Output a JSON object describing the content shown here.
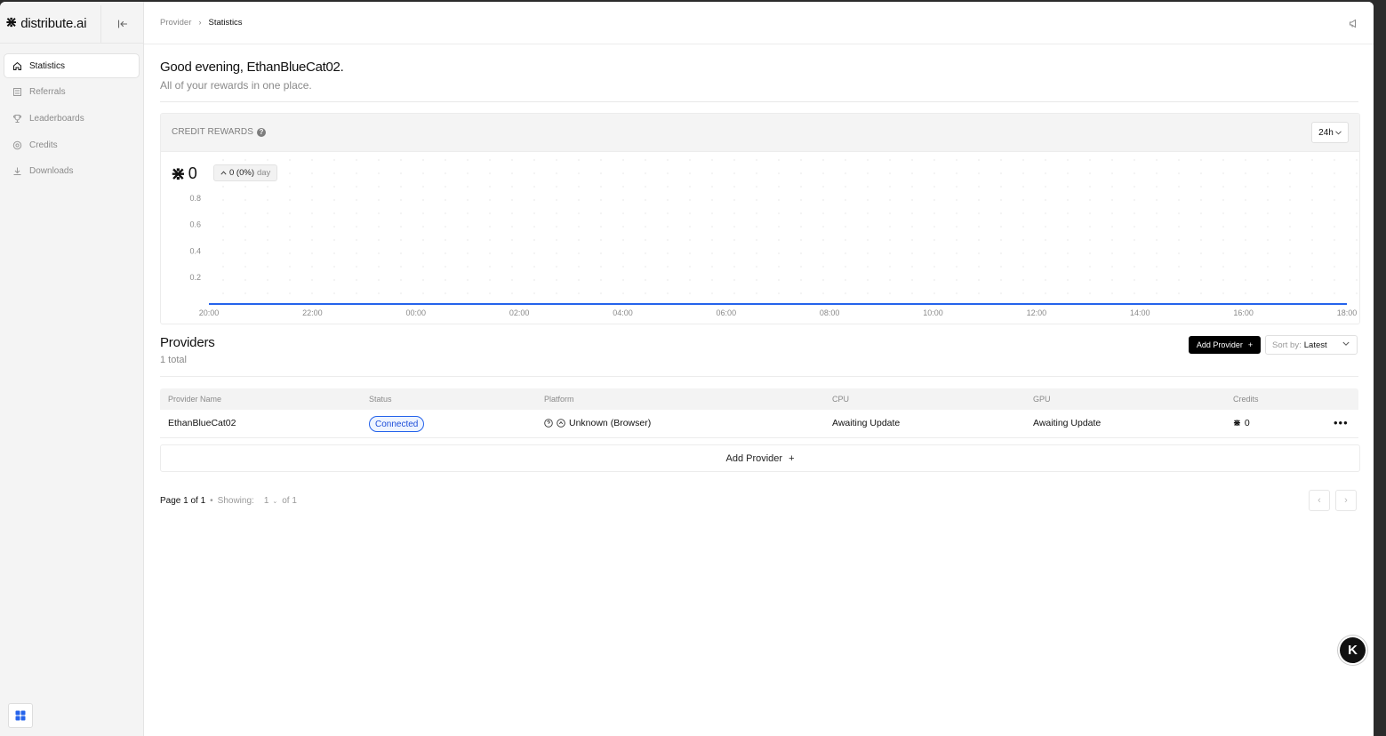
{
  "app": {
    "brand": "distribute.ai"
  },
  "sidebar": {
    "items": [
      {
        "label": "Statistics",
        "icon": "home-icon",
        "active": true
      },
      {
        "label": "Referrals",
        "icon": "referral-icon",
        "active": false
      },
      {
        "label": "Leaderboards",
        "icon": "trophy-icon",
        "active": false
      },
      {
        "label": "Credits",
        "icon": "credits-icon",
        "active": false
      },
      {
        "label": "Downloads",
        "icon": "download-icon",
        "active": false
      }
    ]
  },
  "header": {
    "breadcrumb": [
      "Provider",
      "Statistics"
    ]
  },
  "greeting": {
    "title": "Good evening, EthanBlueCat02.",
    "subtitle": "All of your rewards in one place."
  },
  "credit_rewards": {
    "title": "CREDIT REWARDS",
    "range": "24h",
    "value": "0",
    "delta": "0 (0%)",
    "delta_period": "day"
  },
  "chart_data": {
    "type": "line",
    "title": "CREDIT REWARDS",
    "x": [
      "20:00",
      "22:00",
      "00:00",
      "02:00",
      "04:00",
      "06:00",
      "08:00",
      "10:00",
      "12:00",
      "14:00",
      "16:00",
      "18:00"
    ],
    "series": [
      {
        "values": [
          0,
          0,
          0,
          0,
          0,
          0,
          0,
          0,
          0,
          0,
          0,
          0
        ]
      }
    ],
    "y_ticks": [
      "0.2",
      "0.4",
      "0.6",
      "0.8"
    ],
    "ylim": [
      0,
      0.9
    ],
    "grid": true,
    "line_color": "#2563eb"
  },
  "providers": {
    "title": "Providers",
    "count_text": "1 total",
    "add_button": "Add Provider",
    "sort_label": "Sort by:",
    "sort_value": "Latest",
    "columns": [
      "Provider Name",
      "Status",
      "Platform",
      "CPU",
      "GPU",
      "Credits"
    ],
    "rows": [
      {
        "name": "EthanBlueCat02",
        "status": "Connected",
        "platform": "Unknown (Browser)",
        "cpu": "Awaiting Update",
        "gpu": "Awaiting Update",
        "credits": "0"
      }
    ],
    "add_row": "Add Provider"
  },
  "pagination": {
    "page_text": "Page 1 of 1",
    "showing_label": "Showing:",
    "showing_value": "1",
    "of_text": "of 1"
  },
  "colors": {
    "accent": "#2563eb",
    "primary_button": "#000000"
  }
}
